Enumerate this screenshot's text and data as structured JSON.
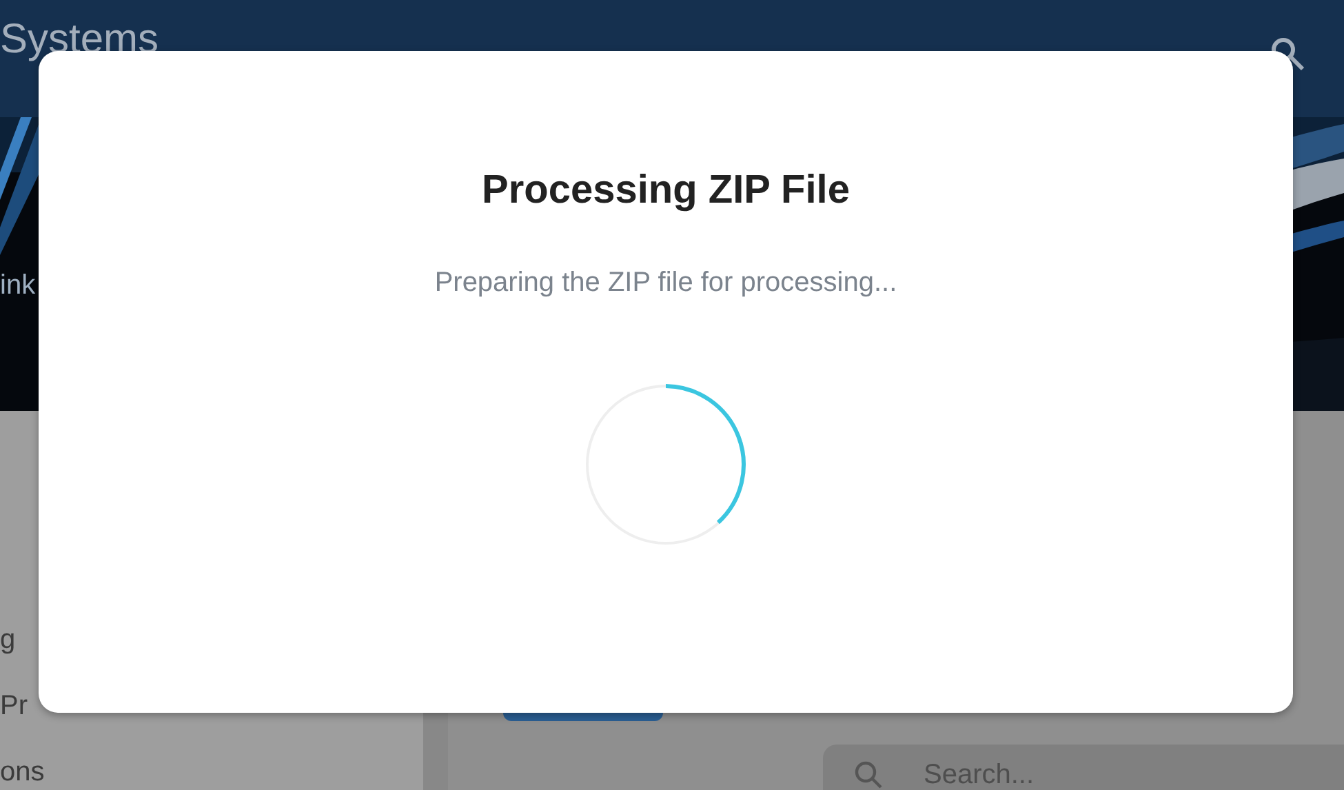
{
  "header": {
    "brand": "Systems"
  },
  "hero": {
    "caption": "ink"
  },
  "sidebar": {
    "items": [
      {
        "label": "g"
      },
      {
        "label": "Pr"
      },
      {
        "label": "ons"
      }
    ]
  },
  "main": {
    "search": {
      "placeholder": "Search..."
    }
  },
  "dialog": {
    "title": "Processing ZIP File",
    "message": "Preparing the ZIP file for processing..."
  }
}
